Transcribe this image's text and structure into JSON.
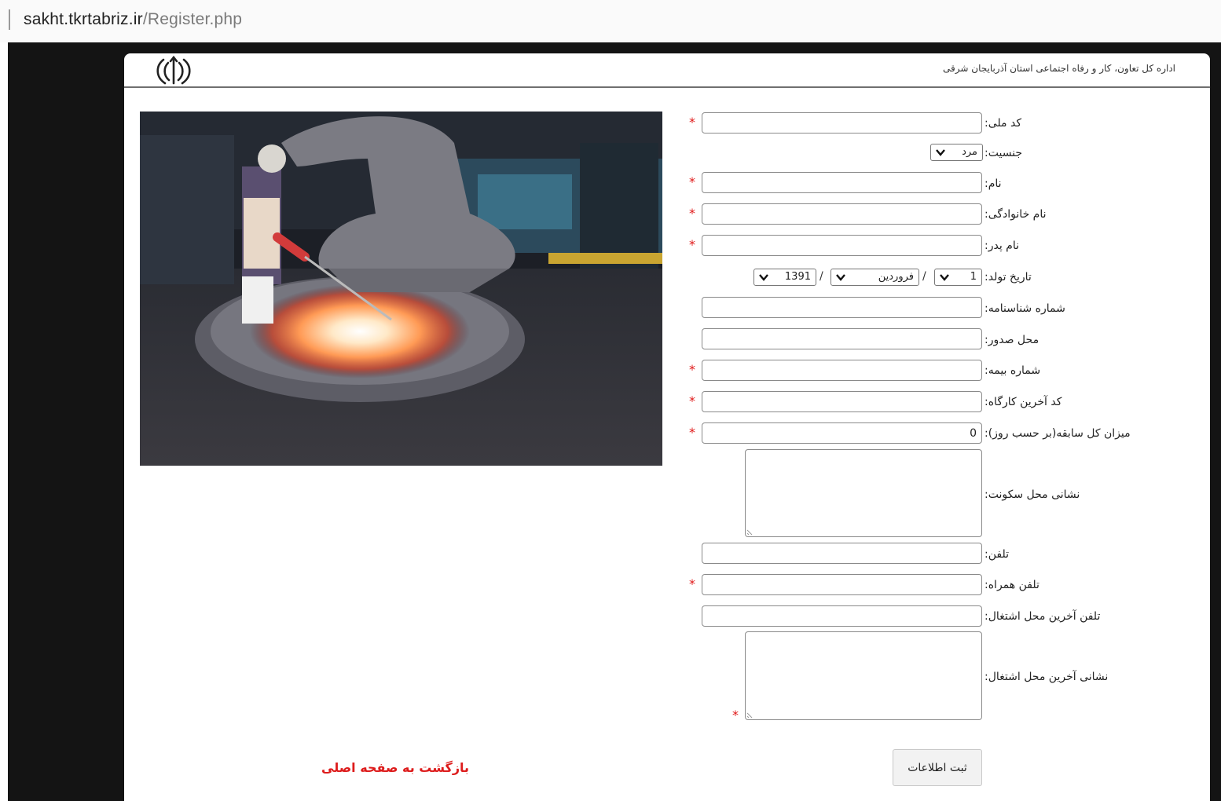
{
  "browser": {
    "url_host": "sakht.tkrtabriz.ir",
    "url_path": "/Register.php"
  },
  "header": {
    "org_title": "اداره کل تعاون، کار و رفاه اجتماعی استان آذربایجان شرقی",
    "emblem_icon": "iran-emblem-icon"
  },
  "form": {
    "national_code_label": "کد ملی:",
    "gender_label": "جنسیت:",
    "gender_value": "مرد",
    "first_name_label": "نام:",
    "last_name_label": "نام خانوادگی:",
    "father_name_label": "نام پدر:",
    "birth_date_label": "تاریخ تولد:",
    "birth_day": "1",
    "birth_month": "فروردین",
    "birth_year": "1391",
    "date_separator": "/",
    "id_number_label": "شماره شناسنامه:",
    "issue_place_label": "محل صدور:",
    "insurance_label": "شماره بیمه:",
    "workshop_code_label": "کد آخرین کارگاه:",
    "experience_label": "میزان کل سابقه(بر حسب روز):",
    "experience_value": "0",
    "address_label": "نشانی محل سکونت:",
    "phone_label": "تلفن:",
    "mobile_label": "تلفن همراه:",
    "last_job_phone_label": "تلفن آخرین محل اشتغال:",
    "last_job_address_label": "نشانی آخرین محل اشتغال:",
    "required_mark": "*",
    "submit_label": "ثبت اطلاعات",
    "back_link": "بازگشت به صفحه اصلی"
  },
  "colors": {
    "required": "#e01818",
    "link": "#dd1c1c",
    "background": "#141414"
  }
}
